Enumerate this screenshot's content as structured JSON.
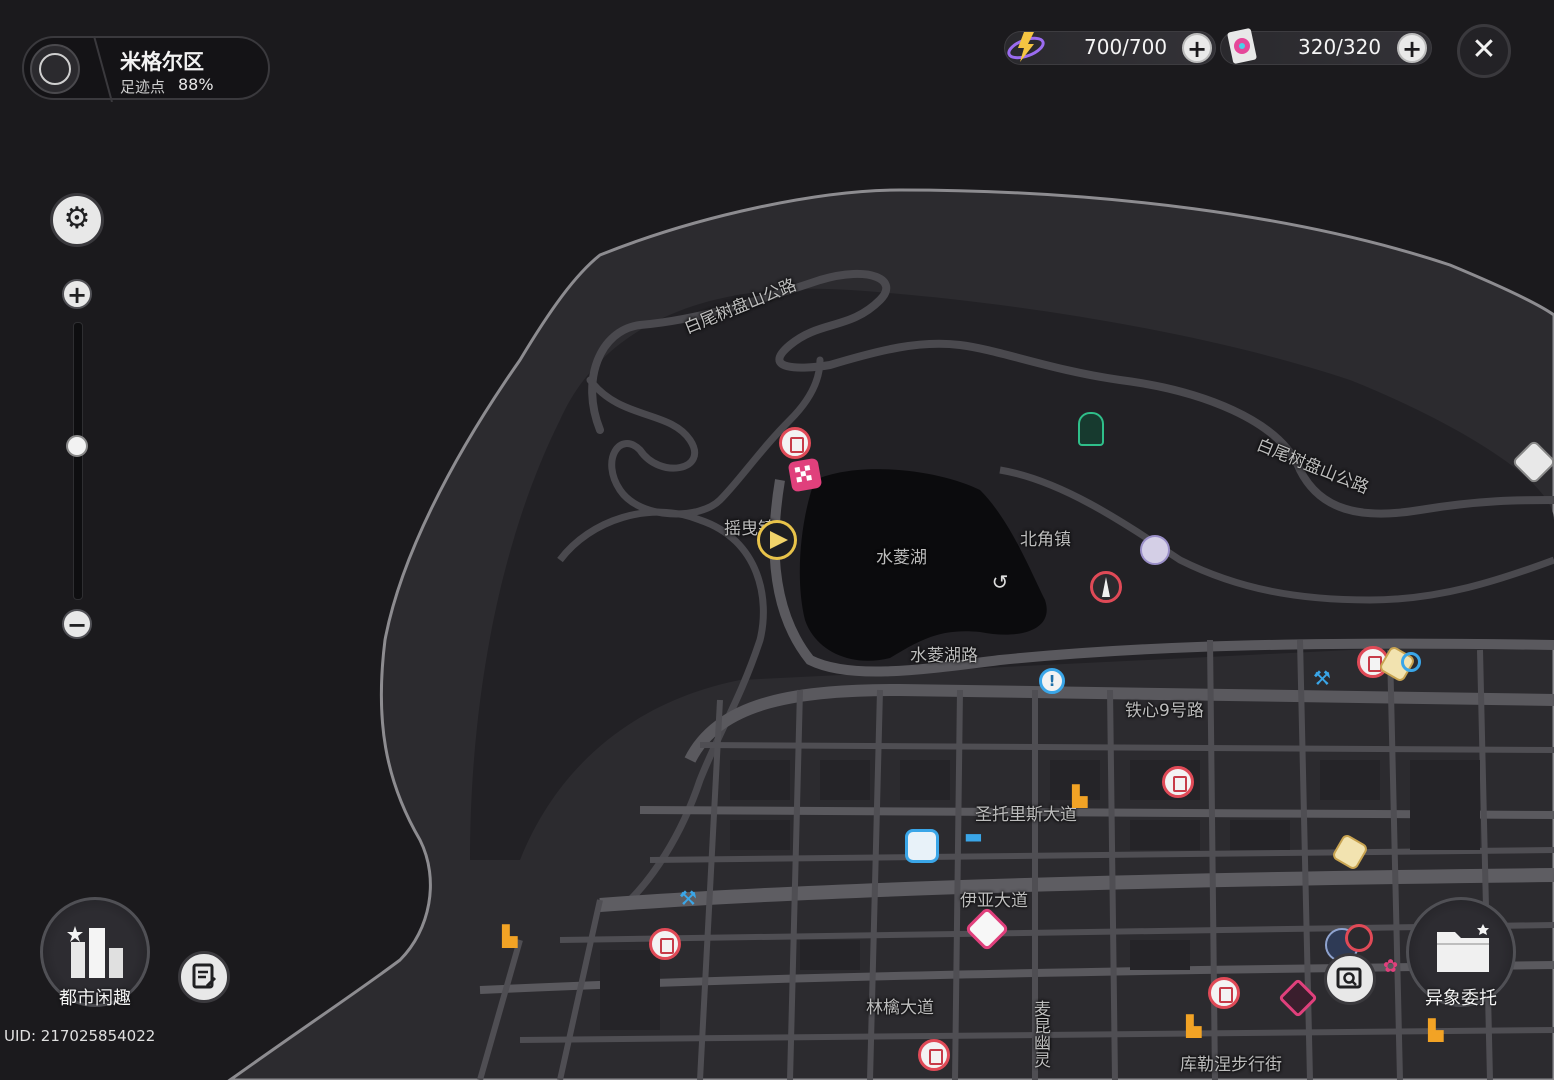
{
  "district": {
    "name": "米格尔区",
    "footprint_label": "足迹点",
    "footprint_value": "88%"
  },
  "resources": [
    {
      "icon": "battery-energy-icon",
      "value": "700/700"
    },
    {
      "icon": "film-reel-icon",
      "value": "320/320"
    }
  ],
  "controls": {
    "plus": "+",
    "minus": "−",
    "close": "✕"
  },
  "zoom": {
    "level": 0.45
  },
  "map_labels": {
    "road_top": "白尾树盘山公路",
    "road_right": "白尾树盘山公路",
    "town_west": "摇曳镇",
    "lake": "水菱湖",
    "town_north": "北角镇",
    "lake_road": "水菱湖路",
    "road_9": "铁心9号路",
    "st_avenue": "圣托里斯大道",
    "iya_avenue": "伊亚大道",
    "linqin_avenue": "林檎大道",
    "vertical_road": "麦昆幽灵",
    "kuller_street": "库勒涅步行街"
  },
  "buttons": {
    "city_fun": "都市闲趣",
    "anomaly_commission": "异象委托"
  },
  "uid_text": "UID: 217025854022",
  "colors": {
    "background": "#1b1a1d",
    "land": "#2f2e32",
    "road": "#5a595e",
    "lake": "#0b0b0d",
    "pin_red": "#e04a57",
    "pin_blue": "#3aa6e8",
    "pin_orange": "#f2a325",
    "pin_pink": "#e0407c",
    "pin_green": "#2fbf8a"
  }
}
